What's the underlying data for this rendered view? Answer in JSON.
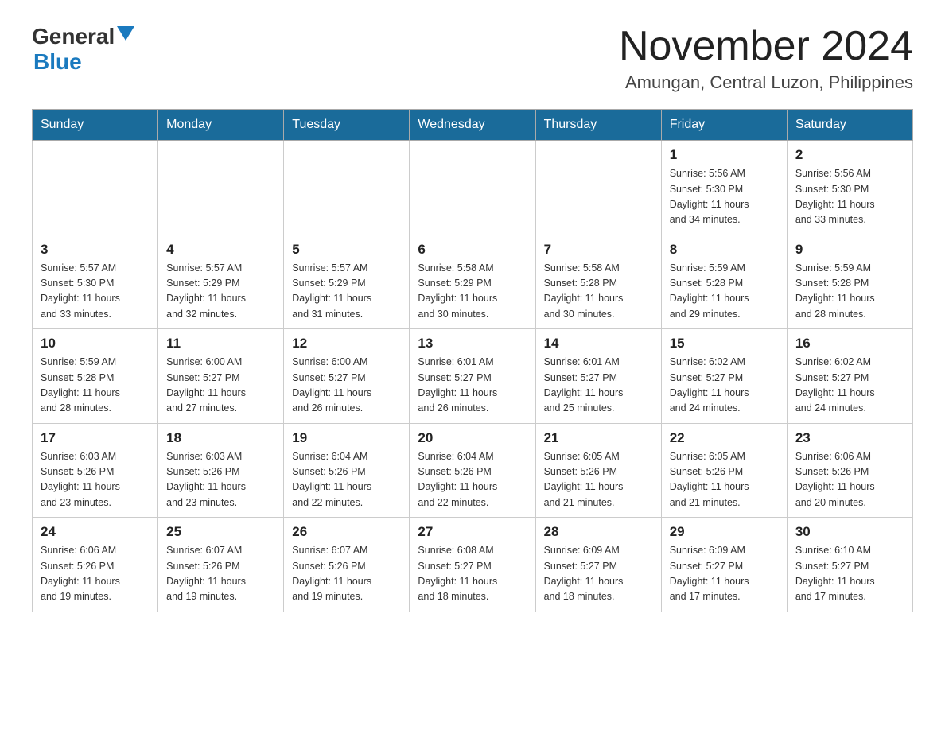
{
  "header": {
    "logo": {
      "general": "General",
      "blue": "Blue"
    },
    "month_year": "November 2024",
    "location": "Amungan, Central Luzon, Philippines"
  },
  "calendar": {
    "days_of_week": [
      "Sunday",
      "Monday",
      "Tuesday",
      "Wednesday",
      "Thursday",
      "Friday",
      "Saturday"
    ],
    "weeks": [
      [
        {
          "day": "",
          "info": ""
        },
        {
          "day": "",
          "info": ""
        },
        {
          "day": "",
          "info": ""
        },
        {
          "day": "",
          "info": ""
        },
        {
          "day": "",
          "info": ""
        },
        {
          "day": "1",
          "info": "Sunrise: 5:56 AM\nSunset: 5:30 PM\nDaylight: 11 hours\nand 34 minutes."
        },
        {
          "day": "2",
          "info": "Sunrise: 5:56 AM\nSunset: 5:30 PM\nDaylight: 11 hours\nand 33 minutes."
        }
      ],
      [
        {
          "day": "3",
          "info": "Sunrise: 5:57 AM\nSunset: 5:30 PM\nDaylight: 11 hours\nand 33 minutes."
        },
        {
          "day": "4",
          "info": "Sunrise: 5:57 AM\nSunset: 5:29 PM\nDaylight: 11 hours\nand 32 minutes."
        },
        {
          "day": "5",
          "info": "Sunrise: 5:57 AM\nSunset: 5:29 PM\nDaylight: 11 hours\nand 31 minutes."
        },
        {
          "day": "6",
          "info": "Sunrise: 5:58 AM\nSunset: 5:29 PM\nDaylight: 11 hours\nand 30 minutes."
        },
        {
          "day": "7",
          "info": "Sunrise: 5:58 AM\nSunset: 5:28 PM\nDaylight: 11 hours\nand 30 minutes."
        },
        {
          "day": "8",
          "info": "Sunrise: 5:59 AM\nSunset: 5:28 PM\nDaylight: 11 hours\nand 29 minutes."
        },
        {
          "day": "9",
          "info": "Sunrise: 5:59 AM\nSunset: 5:28 PM\nDaylight: 11 hours\nand 28 minutes."
        }
      ],
      [
        {
          "day": "10",
          "info": "Sunrise: 5:59 AM\nSunset: 5:28 PM\nDaylight: 11 hours\nand 28 minutes."
        },
        {
          "day": "11",
          "info": "Sunrise: 6:00 AM\nSunset: 5:27 PM\nDaylight: 11 hours\nand 27 minutes."
        },
        {
          "day": "12",
          "info": "Sunrise: 6:00 AM\nSunset: 5:27 PM\nDaylight: 11 hours\nand 26 minutes."
        },
        {
          "day": "13",
          "info": "Sunrise: 6:01 AM\nSunset: 5:27 PM\nDaylight: 11 hours\nand 26 minutes."
        },
        {
          "day": "14",
          "info": "Sunrise: 6:01 AM\nSunset: 5:27 PM\nDaylight: 11 hours\nand 25 minutes."
        },
        {
          "day": "15",
          "info": "Sunrise: 6:02 AM\nSunset: 5:27 PM\nDaylight: 11 hours\nand 24 minutes."
        },
        {
          "day": "16",
          "info": "Sunrise: 6:02 AM\nSunset: 5:27 PM\nDaylight: 11 hours\nand 24 minutes."
        }
      ],
      [
        {
          "day": "17",
          "info": "Sunrise: 6:03 AM\nSunset: 5:26 PM\nDaylight: 11 hours\nand 23 minutes."
        },
        {
          "day": "18",
          "info": "Sunrise: 6:03 AM\nSunset: 5:26 PM\nDaylight: 11 hours\nand 23 minutes."
        },
        {
          "day": "19",
          "info": "Sunrise: 6:04 AM\nSunset: 5:26 PM\nDaylight: 11 hours\nand 22 minutes."
        },
        {
          "day": "20",
          "info": "Sunrise: 6:04 AM\nSunset: 5:26 PM\nDaylight: 11 hours\nand 22 minutes."
        },
        {
          "day": "21",
          "info": "Sunrise: 6:05 AM\nSunset: 5:26 PM\nDaylight: 11 hours\nand 21 minutes."
        },
        {
          "day": "22",
          "info": "Sunrise: 6:05 AM\nSunset: 5:26 PM\nDaylight: 11 hours\nand 21 minutes."
        },
        {
          "day": "23",
          "info": "Sunrise: 6:06 AM\nSunset: 5:26 PM\nDaylight: 11 hours\nand 20 minutes."
        }
      ],
      [
        {
          "day": "24",
          "info": "Sunrise: 6:06 AM\nSunset: 5:26 PM\nDaylight: 11 hours\nand 19 minutes."
        },
        {
          "day": "25",
          "info": "Sunrise: 6:07 AM\nSunset: 5:26 PM\nDaylight: 11 hours\nand 19 minutes."
        },
        {
          "day": "26",
          "info": "Sunrise: 6:07 AM\nSunset: 5:26 PM\nDaylight: 11 hours\nand 19 minutes."
        },
        {
          "day": "27",
          "info": "Sunrise: 6:08 AM\nSunset: 5:27 PM\nDaylight: 11 hours\nand 18 minutes."
        },
        {
          "day": "28",
          "info": "Sunrise: 6:09 AM\nSunset: 5:27 PM\nDaylight: 11 hours\nand 18 minutes."
        },
        {
          "day": "29",
          "info": "Sunrise: 6:09 AM\nSunset: 5:27 PM\nDaylight: 11 hours\nand 17 minutes."
        },
        {
          "day": "30",
          "info": "Sunrise: 6:10 AM\nSunset: 5:27 PM\nDaylight: 11 hours\nand 17 minutes."
        }
      ]
    ]
  }
}
